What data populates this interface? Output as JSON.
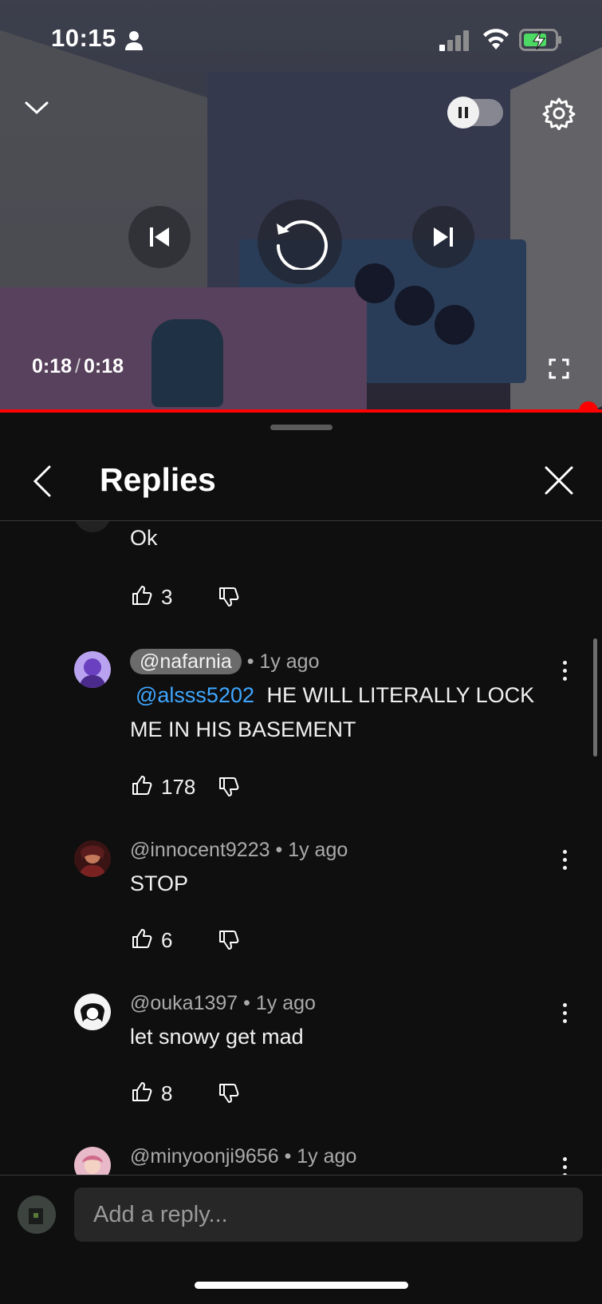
{
  "status_bar": {
    "time": "10:15"
  },
  "player": {
    "current_time": "0:18",
    "duration": "0:18",
    "progress": 1.0,
    "autoplay": "paused-on"
  },
  "replies_panel": {
    "title": "Replies",
    "comments": [
      {
        "handle": "",
        "age": "",
        "text": "Ok",
        "likes": "3"
      },
      {
        "handle": "@nafarnia",
        "age": "1y ago",
        "mention": "@alsss5202",
        "text": "HE WILL LITERALLY LOCK ME IN HIS BASEMENT",
        "likes": "178"
      },
      {
        "handle": "@innocent9223",
        "age": "1y ago",
        "text": "STOP",
        "likes": "6"
      },
      {
        "handle": "@ouka1397",
        "age": "1y ago",
        "text": "let snowy get mad",
        "likes": "8"
      },
      {
        "handle": "@minyoonji9656",
        "age": "1y ago"
      }
    ],
    "separator": "•"
  },
  "composer": {
    "placeholder": "Add a reply..."
  },
  "colors": {
    "progress": "#ff0000",
    "mention": "#3ea6ff",
    "background": "#0f0f0f"
  }
}
